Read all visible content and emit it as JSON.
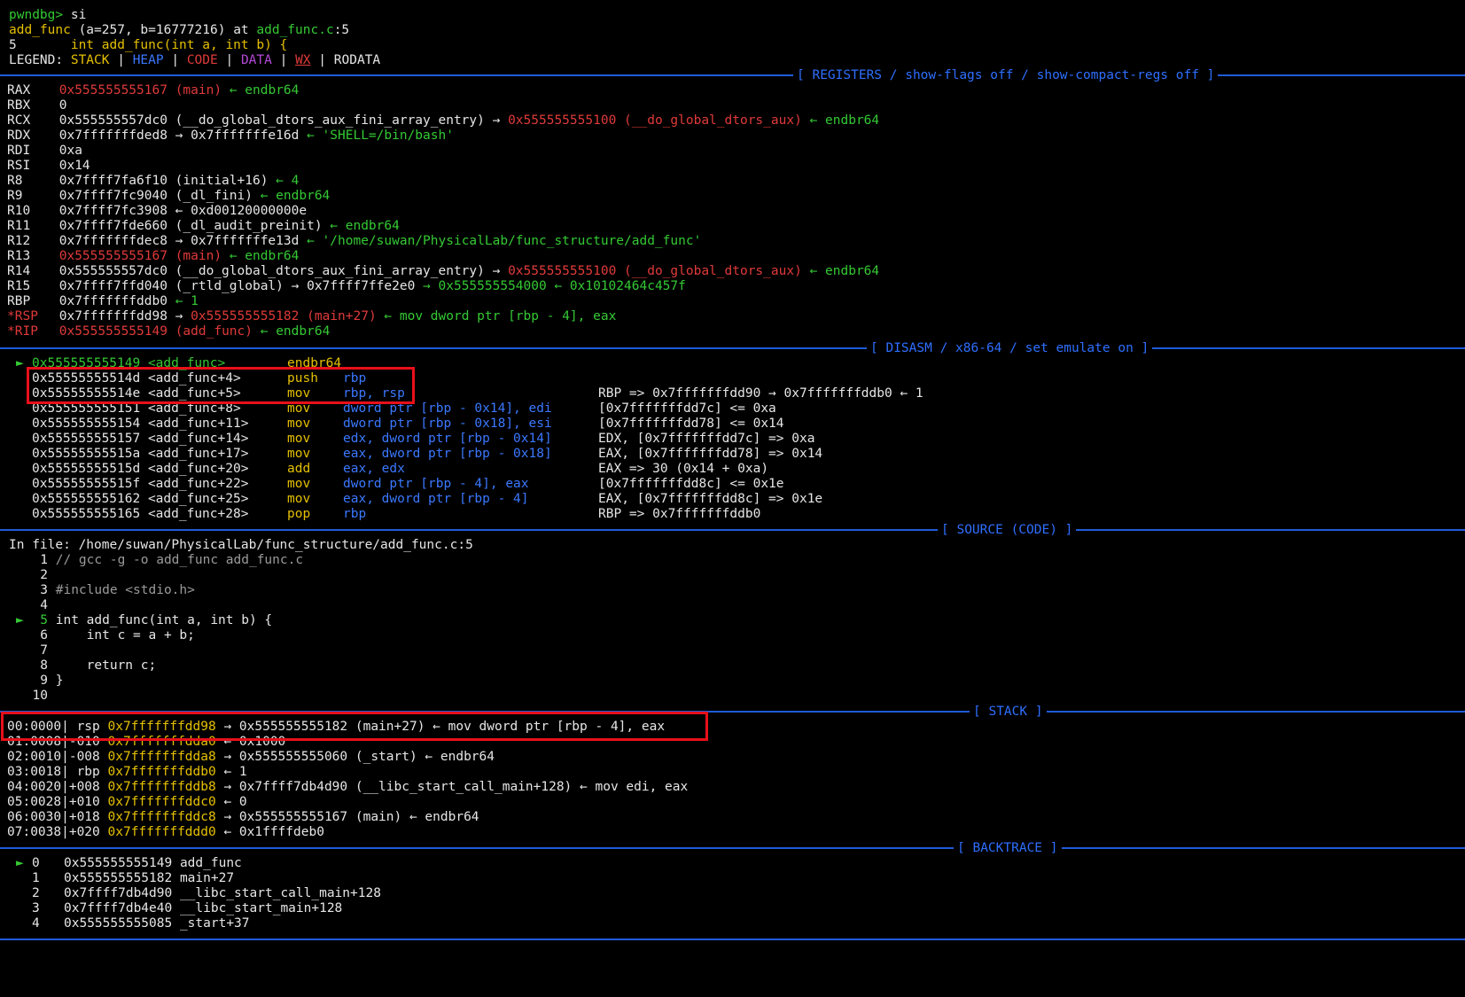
{
  "header": {
    "prompt": "pwndbg>",
    "command": "si",
    "frame_func": "add_func",
    "frame_args": "(a=257, b=16777216)",
    "frame_at": "at",
    "frame_file": "add_func.c",
    "frame_line": ":5",
    "src_line_no": "5",
    "src_line_text": "int add_func(int a, int b) {"
  },
  "legend": {
    "label": "LEGEND:",
    "stack": "STACK",
    "heap": "HEAP",
    "code": "CODE",
    "data": "DATA",
    "wx": "WX",
    "rodata": "RODATA",
    "sep": "|"
  },
  "sections": {
    "registers": "[ REGISTERS / show-flags off / show-compact-regs off ]",
    "disasm": "[ DISASM / x86-64 / set emulate on ]",
    "source": "[ SOURCE (CODE) ]",
    "stack": "[ STACK ]",
    "backtrace": "[ BACKTRACE ]"
  },
  "registers": [
    {
      "name": "RAX",
      "addr": "0x555555555167",
      "sym": "(main)",
      "tail": "← endbr64"
    },
    {
      "name": "RBX",
      "value": "0"
    },
    {
      "name": "RCX",
      "value": "0x555555557dc0 (__do_global_dtors_aux_fini_array_entry) →",
      "addr": "0x555555555100",
      "sym": "(__do_global_dtors_aux)",
      "tail": "← endbr64"
    },
    {
      "name": "RDX",
      "value": "0x7fffffffded8 → 0x7fffffffe16d",
      "tail": "← 'SHELL=/bin/bash'"
    },
    {
      "name": "RDI",
      "value": "0xa"
    },
    {
      "name": "RSI",
      "value": "0x14"
    },
    {
      "name": "R8",
      "value": "0x7ffff7fa6f10 (initial+16)",
      "tail": "← 4"
    },
    {
      "name": "R9",
      "value": "0x7ffff7fc9040 (_dl_fini)",
      "tail": "← endbr64"
    },
    {
      "name": "R10",
      "value": "0x7ffff7fc3908 ← 0xd00120000000e"
    },
    {
      "name": "R11",
      "value": "0x7ffff7fde660 (_dl_audit_preinit)",
      "tail": "← endbr64"
    },
    {
      "name": "R12",
      "value": "0x7fffffffdec8 → 0x7fffffffe13d",
      "tail": "← '/home/suwan/PhysicalLab/func_structure/add_func'"
    },
    {
      "name": "R13",
      "addr": "0x555555555167",
      "sym": "(main)",
      "tail": "← endbr64"
    },
    {
      "name": "R14",
      "value": "0x555555557dc0 (__do_global_dtors_aux_fini_array_entry) →",
      "addr": "0x555555555100",
      "sym": "(__do_global_dtors_aux)",
      "tail": "← endbr64"
    },
    {
      "name": "R15",
      "value": "0x7ffff7ffd040 (_rtld_global) → 0x7ffff7ffe2e0",
      "tail": "→ 0x555555554000 ← 0x10102464c457f"
    },
    {
      "name": "RBP",
      "value": "0x7fffffffddb0",
      "tail": "← 1"
    },
    {
      "name": "*RSP",
      "value": "0x7fffffffdd98 →",
      "addr": "0x555555555182",
      "sym": "(main+27)",
      "tail": "← mov dword ptr [rbp - 4], eax"
    },
    {
      "name": "*RIP",
      "addr": "0x555555555149",
      "sym": "(add_func)",
      "tail": "← endbr64"
    }
  ],
  "disasm": [
    {
      "marker": "►",
      "addr": "0x555555555149 <add_func>",
      "mn": "endbr64",
      "ops": "",
      "note": ""
    },
    {
      "marker": "",
      "addr": "0x55555555514d <add_func+4>",
      "mn": "push",
      "ops": "rbp",
      "note": ""
    },
    {
      "marker": "",
      "addr": "0x55555555514e <add_func+5>",
      "mn": "mov",
      "ops": "rbp, rsp",
      "note": "RBP => 0x7fffffffdd90 → 0x7fffffffddb0 ← 1"
    },
    {
      "marker": "",
      "addr": "0x555555555151 <add_func+8>",
      "mn": "mov",
      "ops": "dword ptr [rbp - 0x14], edi",
      "note": "[0x7fffffffdd7c] <= 0xa"
    },
    {
      "marker": "",
      "addr": "0x555555555154 <add_func+11>",
      "mn": "mov",
      "ops": "dword ptr [rbp - 0x18], esi",
      "note": "[0x7fffffffdd78] <= 0x14"
    },
    {
      "marker": "",
      "addr": "0x555555555157 <add_func+14>",
      "mn": "mov",
      "ops": "edx, dword ptr [rbp - 0x14]",
      "note": "EDX, [0x7fffffffdd7c] => 0xa"
    },
    {
      "marker": "",
      "addr": "0x55555555515a <add_func+17>",
      "mn": "mov",
      "ops": "eax, dword ptr [rbp - 0x18]",
      "note": "EAX, [0x7fffffffdd78] => 0x14"
    },
    {
      "marker": "",
      "addr": "0x55555555515d <add_func+20>",
      "mn": "add",
      "ops": "eax, edx",
      "note": "EAX => 30 (0x14 + 0xa)"
    },
    {
      "marker": "",
      "addr": "0x55555555515f <add_func+22>",
      "mn": "mov",
      "ops": "dword ptr [rbp - 4], eax",
      "note": "[0x7fffffffdd8c] <= 0x1e"
    },
    {
      "marker": "",
      "addr": "0x555555555162 <add_func+25>",
      "mn": "mov",
      "ops": "eax, dword ptr [rbp - 4]",
      "note": "EAX, [0x7fffffffdd8c] => 0x1e"
    },
    {
      "marker": "",
      "addr": "0x555555555165 <add_func+28>",
      "mn": "pop",
      "ops": "rbp",
      "note": "RBP => 0x7fffffffddb0"
    }
  ],
  "source": {
    "in_file_label": "In file:",
    "path": "/home/suwan/PhysicalLab/func_structure/add_func.c:5",
    "lines": [
      {
        "no": "1",
        "marker": "",
        "text": "// gcc -g -o add_func add_func.c"
      },
      {
        "no": "2",
        "marker": "",
        "text": ""
      },
      {
        "no": "3",
        "marker": "",
        "text": "#include <stdio.h>"
      },
      {
        "no": "4",
        "marker": "",
        "text": ""
      },
      {
        "no": "5",
        "marker": "►",
        "text": "int add_func(int a, int b) {"
      },
      {
        "no": "6",
        "marker": "",
        "text": "    int c = a + b;"
      },
      {
        "no": "7",
        "marker": "",
        "text": ""
      },
      {
        "no": "8",
        "marker": "",
        "text": "    return c;"
      },
      {
        "no": "9",
        "marker": "",
        "text": "}"
      },
      {
        "no": "10",
        "marker": "",
        "text": ""
      }
    ]
  },
  "stack": [
    {
      "idx": "00:0000",
      "off": " rsp",
      "addr": "0x7fffffffdd98",
      "rest": "→ 0x555555555182 (main+27) ← mov dword ptr [rbp - 4], eax"
    },
    {
      "idx": "01:0008",
      "off": "-010",
      "addr": "0x7fffffffdda0",
      "rest": "← 0x1000"
    },
    {
      "idx": "02:0010",
      "off": "-008",
      "addr": "0x7fffffffdda8",
      "rest": "→ 0x555555555060 (_start) ← endbr64"
    },
    {
      "idx": "03:0018",
      "off": " rbp",
      "addr": "0x7fffffffddb0",
      "rest": "← 1"
    },
    {
      "idx": "04:0020",
      "off": "+008",
      "addr": "0x7fffffffddb8",
      "rest": "→ 0x7ffff7db4d90 (__libc_start_call_main+128) ← mov edi, eax"
    },
    {
      "idx": "05:0028",
      "off": "+010",
      "addr": "0x7fffffffddc0",
      "rest": "← 0"
    },
    {
      "idx": "06:0030",
      "off": "+018",
      "addr": "0x7fffffffddc8",
      "rest": "→ 0x555555555167 (main) ← endbr64"
    },
    {
      "idx": "07:0038",
      "off": "+020",
      "addr": "0x7fffffffddd0",
      "rest": "← 0x1ffffdeb0"
    }
  ],
  "backtrace": [
    {
      "marker": "►",
      "n": "0",
      "addr": "0x555555555149",
      "sym": "add_func"
    },
    {
      "marker": "",
      "n": "1",
      "addr": "0x555555555182",
      "sym": "main+27"
    },
    {
      "marker": "",
      "n": "2",
      "addr": "0x7ffff7db4d90",
      "sym": "__libc_start_call_main+128"
    },
    {
      "marker": "",
      "n": "3",
      "addr": "0x7ffff7db4e40",
      "sym": "__libc_start_main+128"
    },
    {
      "marker": "",
      "n": "4",
      "addr": "0x555555555085",
      "sym": "_start+37"
    }
  ],
  "colors": {
    "background": "#000000",
    "rule": "#1f5bd8",
    "highlight_box": "#e8101a",
    "code": "#e03a3a",
    "stack": "#e5c000",
    "heap": "#3b78ff",
    "data": "#b348d6",
    "current": "#34c934"
  }
}
